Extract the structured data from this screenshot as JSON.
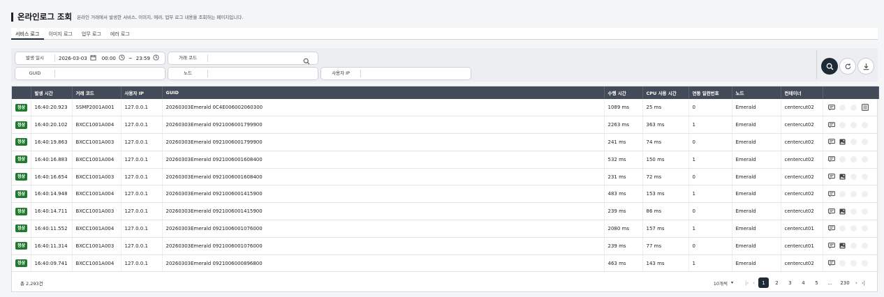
{
  "header": {
    "title": "온라인로그 조회",
    "subtitle": "온라인 거래에서 발생한 서비스, 이미지, 에러, 업무 로그 내용을 조회하는 페이지입니다."
  },
  "tabs": [
    {
      "label": "서비스 로그",
      "active": true
    },
    {
      "label": "이미지 로그"
    },
    {
      "label": "업무 로그"
    },
    {
      "label": "에러 로그"
    }
  ],
  "search": {
    "date_label": "발생 일시",
    "date_value": "2026-03-03",
    "time_start": "00:00",
    "tilde": "~",
    "time_end": "23:59",
    "tx_code_label": "거래 코드",
    "tx_code_value": "",
    "guid_label": "GUID",
    "guid_value": "",
    "node_label": "노드",
    "node_value": "",
    "user_ip_label": "사용자 IP",
    "user_ip_value": ""
  },
  "table": {
    "columns": [
      "",
      "발생 시간",
      "거래 코드",
      "사용자 IP",
      "GUID",
      "수행 시간",
      "CPU 사용 시간",
      "연동 일련번호",
      "노드",
      "컨테이너",
      ""
    ],
    "rows": [
      {
        "status": "정상",
        "time": "16:40:20.923",
        "code": "SSMP2001A001",
        "ip": "127.0.0.1",
        "guid": "20260303Emerald 0C4E006002060300",
        "exec": "1089 ms",
        "cpu": "25 ms",
        "seq": "0",
        "node": "Emerald",
        "container": "centercut02",
        "actions": [
          1,
          0,
          0,
          1
        ]
      },
      {
        "status": "정상",
        "time": "16:40:20.102",
        "code": "BXCC1001A004",
        "ip": "127.0.0.1",
        "guid": "20260303Emerald 0921006001799900",
        "exec": "2263 ms",
        "cpu": "363 ms",
        "seq": "1",
        "node": "Emerald",
        "container": "centercut02",
        "actions": [
          1,
          0,
          0,
          0
        ]
      },
      {
        "status": "정상",
        "time": "16:40:19.863",
        "code": "BXCC1001A003",
        "ip": "127.0.0.1",
        "guid": "20260303Emerald 0921006001799900",
        "exec": "241 ms",
        "cpu": "74 ms",
        "seq": "0",
        "node": "Emerald",
        "container": "centercut02",
        "actions": [
          1,
          1,
          0,
          0
        ]
      },
      {
        "status": "정상",
        "time": "16:40:16.883",
        "code": "BXCC1001A004",
        "ip": "127.0.0.1",
        "guid": "20260303Emerald 0921006001608400",
        "exec": "532 ms",
        "cpu": "150 ms",
        "seq": "1",
        "node": "Emerald",
        "container": "centercut02",
        "actions": [
          1,
          0,
          0,
          0
        ]
      },
      {
        "status": "정상",
        "time": "16:40:16.654",
        "code": "BXCC1001A003",
        "ip": "127.0.0.1",
        "guid": "20260303Emerald 0921006001608400",
        "exec": "231 ms",
        "cpu": "72 ms",
        "seq": "0",
        "node": "Emerald",
        "container": "centercut02",
        "actions": [
          1,
          1,
          0,
          0
        ]
      },
      {
        "status": "정상",
        "time": "16:40:14.948",
        "code": "BXCC1001A004",
        "ip": "127.0.0.1",
        "guid": "20260303Emerald 0921006001415900",
        "exec": "483 ms",
        "cpu": "153 ms",
        "seq": "1",
        "node": "Emerald",
        "container": "centercut02",
        "actions": [
          1,
          0,
          0,
          0
        ]
      },
      {
        "status": "정상",
        "time": "16:40:14.711",
        "code": "BXCC1001A003",
        "ip": "127.0.0.1",
        "guid": "20260303Emerald 0921006001415900",
        "exec": "239 ms",
        "cpu": "86 ms",
        "seq": "0",
        "node": "Emerald",
        "container": "centercut02",
        "actions": [
          1,
          1,
          0,
          0
        ]
      },
      {
        "status": "정상",
        "time": "16:40:11.552",
        "code": "BXCC1001A004",
        "ip": "127.0.0.1",
        "guid": "20260303Emerald 0921006001076000",
        "exec": "2080 ms",
        "cpu": "157 ms",
        "seq": "1",
        "node": "Emerald",
        "container": "centercut01",
        "actions": [
          1,
          0,
          0,
          0
        ]
      },
      {
        "status": "정상",
        "time": "16:40:11.314",
        "code": "BXCC1001A003",
        "ip": "127.0.0.1",
        "guid": "20260303Emerald 0921006001076000",
        "exec": "239 ms",
        "cpu": "77 ms",
        "seq": "0",
        "node": "Emerald",
        "container": "centercut01",
        "actions": [
          1,
          1,
          0,
          0
        ]
      },
      {
        "status": "정상",
        "time": "16:40:09.741",
        "code": "BXCC1001A004",
        "ip": "127.0.0.1",
        "guid": "20260303Emerald 0921006000896800",
        "exec": "463 ms",
        "cpu": "143 ms",
        "seq": "1",
        "node": "Emerald",
        "container": "centercut02",
        "actions": [
          1,
          0,
          0,
          0
        ]
      }
    ]
  },
  "footer": {
    "total": "총 2,293건",
    "page_size": "10개씩",
    "pages": [
      "1",
      "2",
      "3",
      "4",
      "5",
      "...",
      "230"
    ],
    "current_page": "1"
  },
  "colors": {
    "accent": "#1f2a37",
    "header_bg": "#424b57",
    "status_ok": "#1f7a2e"
  },
  "icons": {
    "calendar": "calendar-icon",
    "clock": "clock-icon",
    "search": "search-icon",
    "reset": "refresh-icon",
    "download": "download-icon",
    "message": "message-icon",
    "image": "image-icon",
    "detail": "detail-icon"
  }
}
